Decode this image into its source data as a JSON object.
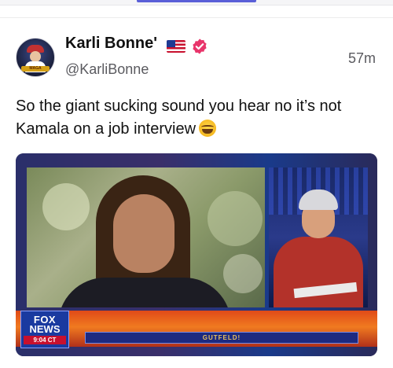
{
  "post": {
    "author_name": "Karli Bonne'",
    "handle": "@KarliBonne",
    "timestamp": "57m",
    "text": "So the giant sucking sound you hear no it’s not Kamala on a job interview",
    "text_emoji": "laughing-tears-emoji",
    "badges": [
      "us-flag-icon",
      "verified-icon"
    ],
    "verified_color": "#e8356b"
  },
  "avatar": {
    "badge_text": "MAGA"
  },
  "media": {
    "network_logo_line1": "FOX",
    "network_logo_line2": "NEWS",
    "clock": "9:04 CT",
    "ticker_text": "GUTFELD!"
  },
  "colors": {
    "accent": "#5a5fd8",
    "text_primary": "#111111",
    "text_secondary": "#5a5a5f"
  }
}
